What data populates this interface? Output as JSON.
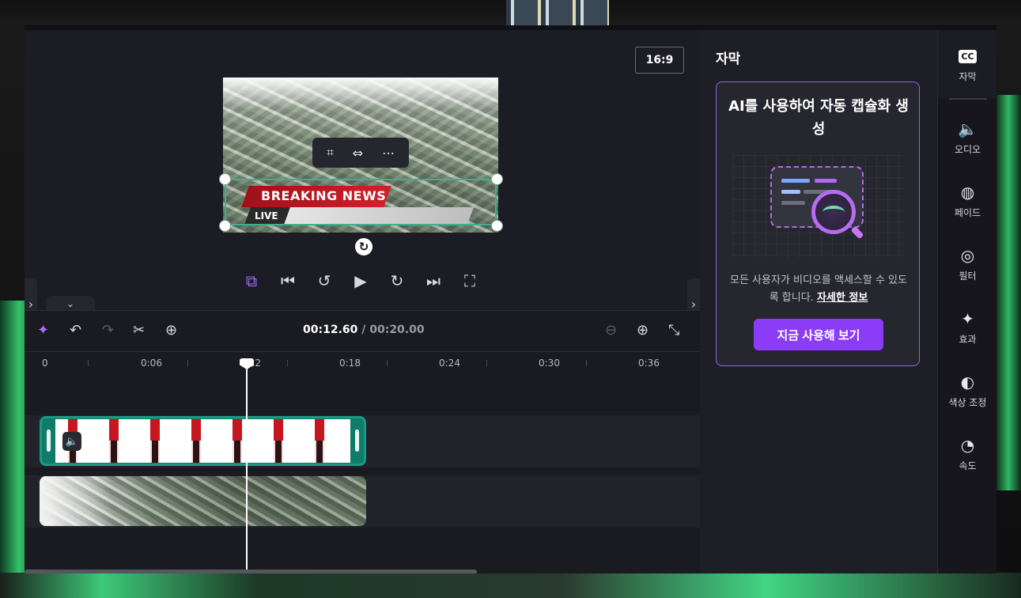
{
  "preview": {
    "aspect_ratio": "16:9",
    "overlay_headline": "BREAKING NEWS",
    "overlay_tag": "LIVE",
    "toolbar_icons": [
      "crop-icon",
      "fit-icon",
      "more-icon"
    ],
    "playback_icons": [
      "ai-scene-icon",
      "skip-start-icon",
      "rewind-5-icon",
      "play-icon",
      "forward-5-icon",
      "skip-end-icon",
      "fullscreen-icon"
    ]
  },
  "timeline": {
    "current_time": "00:12.60",
    "total_time": "/ 00:20.00",
    "ruler": [
      "0",
      "0:06",
      "0:12",
      "0:18",
      "0:24",
      "0:30",
      "0:36"
    ],
    "tool_icons": [
      "ai-sparkle-icon",
      "undo-icon",
      "redo-icon",
      "split-icon",
      "add-media-icon",
      "zoom-out-icon",
      "zoom-in-icon",
      "fit-timeline-icon"
    ]
  },
  "panel": {
    "title": "자막",
    "promo_title": "AI를 사용하여 자동 캡슐화 생성",
    "promo_desc": "모든 사용자가 비디오를 액세스할 수 있도록 합니다.",
    "promo_link": "자세한 정보",
    "promo_button": "지금 사용해 보기"
  },
  "rail": [
    {
      "icon": "cc-icon",
      "glyph": "CC",
      "label": "자막"
    },
    {
      "icon": "audio-icon",
      "glyph": "🔈",
      "label": "오디오"
    },
    {
      "icon": "fade-icon",
      "glyph": "◍",
      "label": "페이드"
    },
    {
      "icon": "filter-icon",
      "glyph": "◎",
      "label": "필터"
    },
    {
      "icon": "effects-icon",
      "glyph": "✦",
      "label": "효과"
    },
    {
      "icon": "color-adjust-icon",
      "glyph": "◐",
      "label": "색상 조정"
    },
    {
      "icon": "speed-icon",
      "glyph": "◔",
      "label": "속도"
    }
  ],
  "colors": {
    "accent": "#8b3cf6",
    "clip_selected": "#1a9a82",
    "panel_bg": "#1e1e26"
  }
}
